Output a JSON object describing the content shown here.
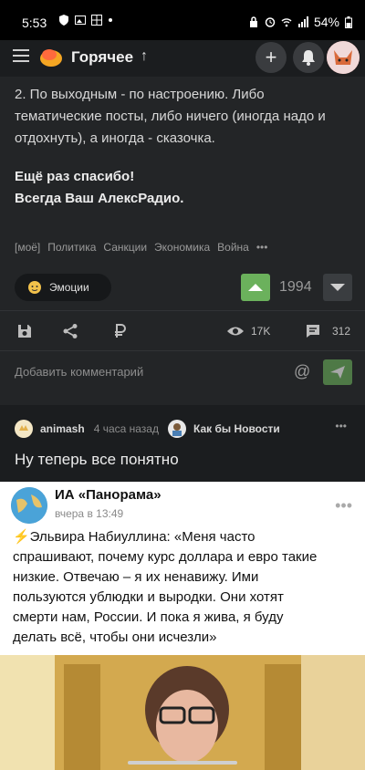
{
  "status_bar": {
    "time": "5:53",
    "battery": "54%"
  },
  "header": {
    "title": "Горячее",
    "sort_arrow": "↑",
    "add": "+"
  },
  "post": {
    "paragraph": [
      "2. По выходным - по настроению. Либо",
      "тематические посты, либо ничего (иногда надо и",
      "отдохнуть), а иногда - сказочка."
    ],
    "thanks": [
      "Ещё раз спасибо!",
      "Всегда Ваш АлексРадио."
    ],
    "tags": [
      "[моё]",
      "Политика",
      "Санкции",
      "Экономика",
      "Война",
      "•••"
    ],
    "emotion_label": "Эмоции",
    "rating": "1994",
    "views": "17K",
    "comments": "312",
    "comment_placeholder": "Добавить комментарий",
    "at": "@"
  },
  "next_post": {
    "author": "animash",
    "time": "4 часа назад",
    "community": "Как бы Новости",
    "more": "•••",
    "title": "Ну теперь все понятно"
  },
  "embed": {
    "channel": "ИА «Панорама»",
    "time": "вчера в 13:49",
    "more": "•••",
    "text_lines": [
      "⚡Эльвира Набиуллина: «Меня часто",
      "спрашивают, почему курс доллара и евро такие",
      "низкие. Отвечаю – я их ненавижу. Ими",
      "пользуются ублюдки и выродки. Они хотят",
      "смерти нам, России. И пока я жива, я буду",
      "делать всё, чтобы они исчезли»"
    ]
  },
  "icons": [
    "menu-icon",
    "hot-logo-icon",
    "plus-icon",
    "bell-icon",
    "save-icon",
    "share-icon",
    "ruble-icon",
    "eye-icon",
    "comment-icon",
    "send-icon"
  ],
  "colors": {
    "accent": "#6bb15c",
    "bg": "#1b1d1f",
    "card": "#232527"
  }
}
